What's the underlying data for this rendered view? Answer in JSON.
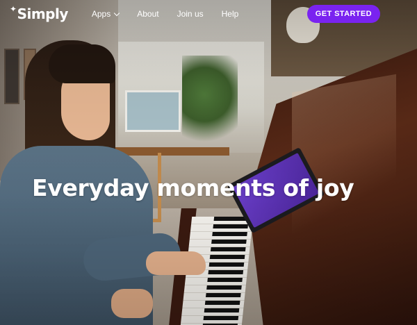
{
  "brand": {
    "name": "Simply",
    "spark_icon": "sparkle-icon"
  },
  "nav": {
    "items": [
      {
        "label": "Apps",
        "has_dropdown": true
      },
      {
        "label": "About"
      },
      {
        "label": "Join us"
      },
      {
        "label": "Help"
      }
    ],
    "cta_label": "GET STARTED"
  },
  "hero": {
    "headline": "Everyday moments of joy"
  },
  "colors": {
    "accent": "#7a23f0",
    "text": "#ffffff"
  }
}
